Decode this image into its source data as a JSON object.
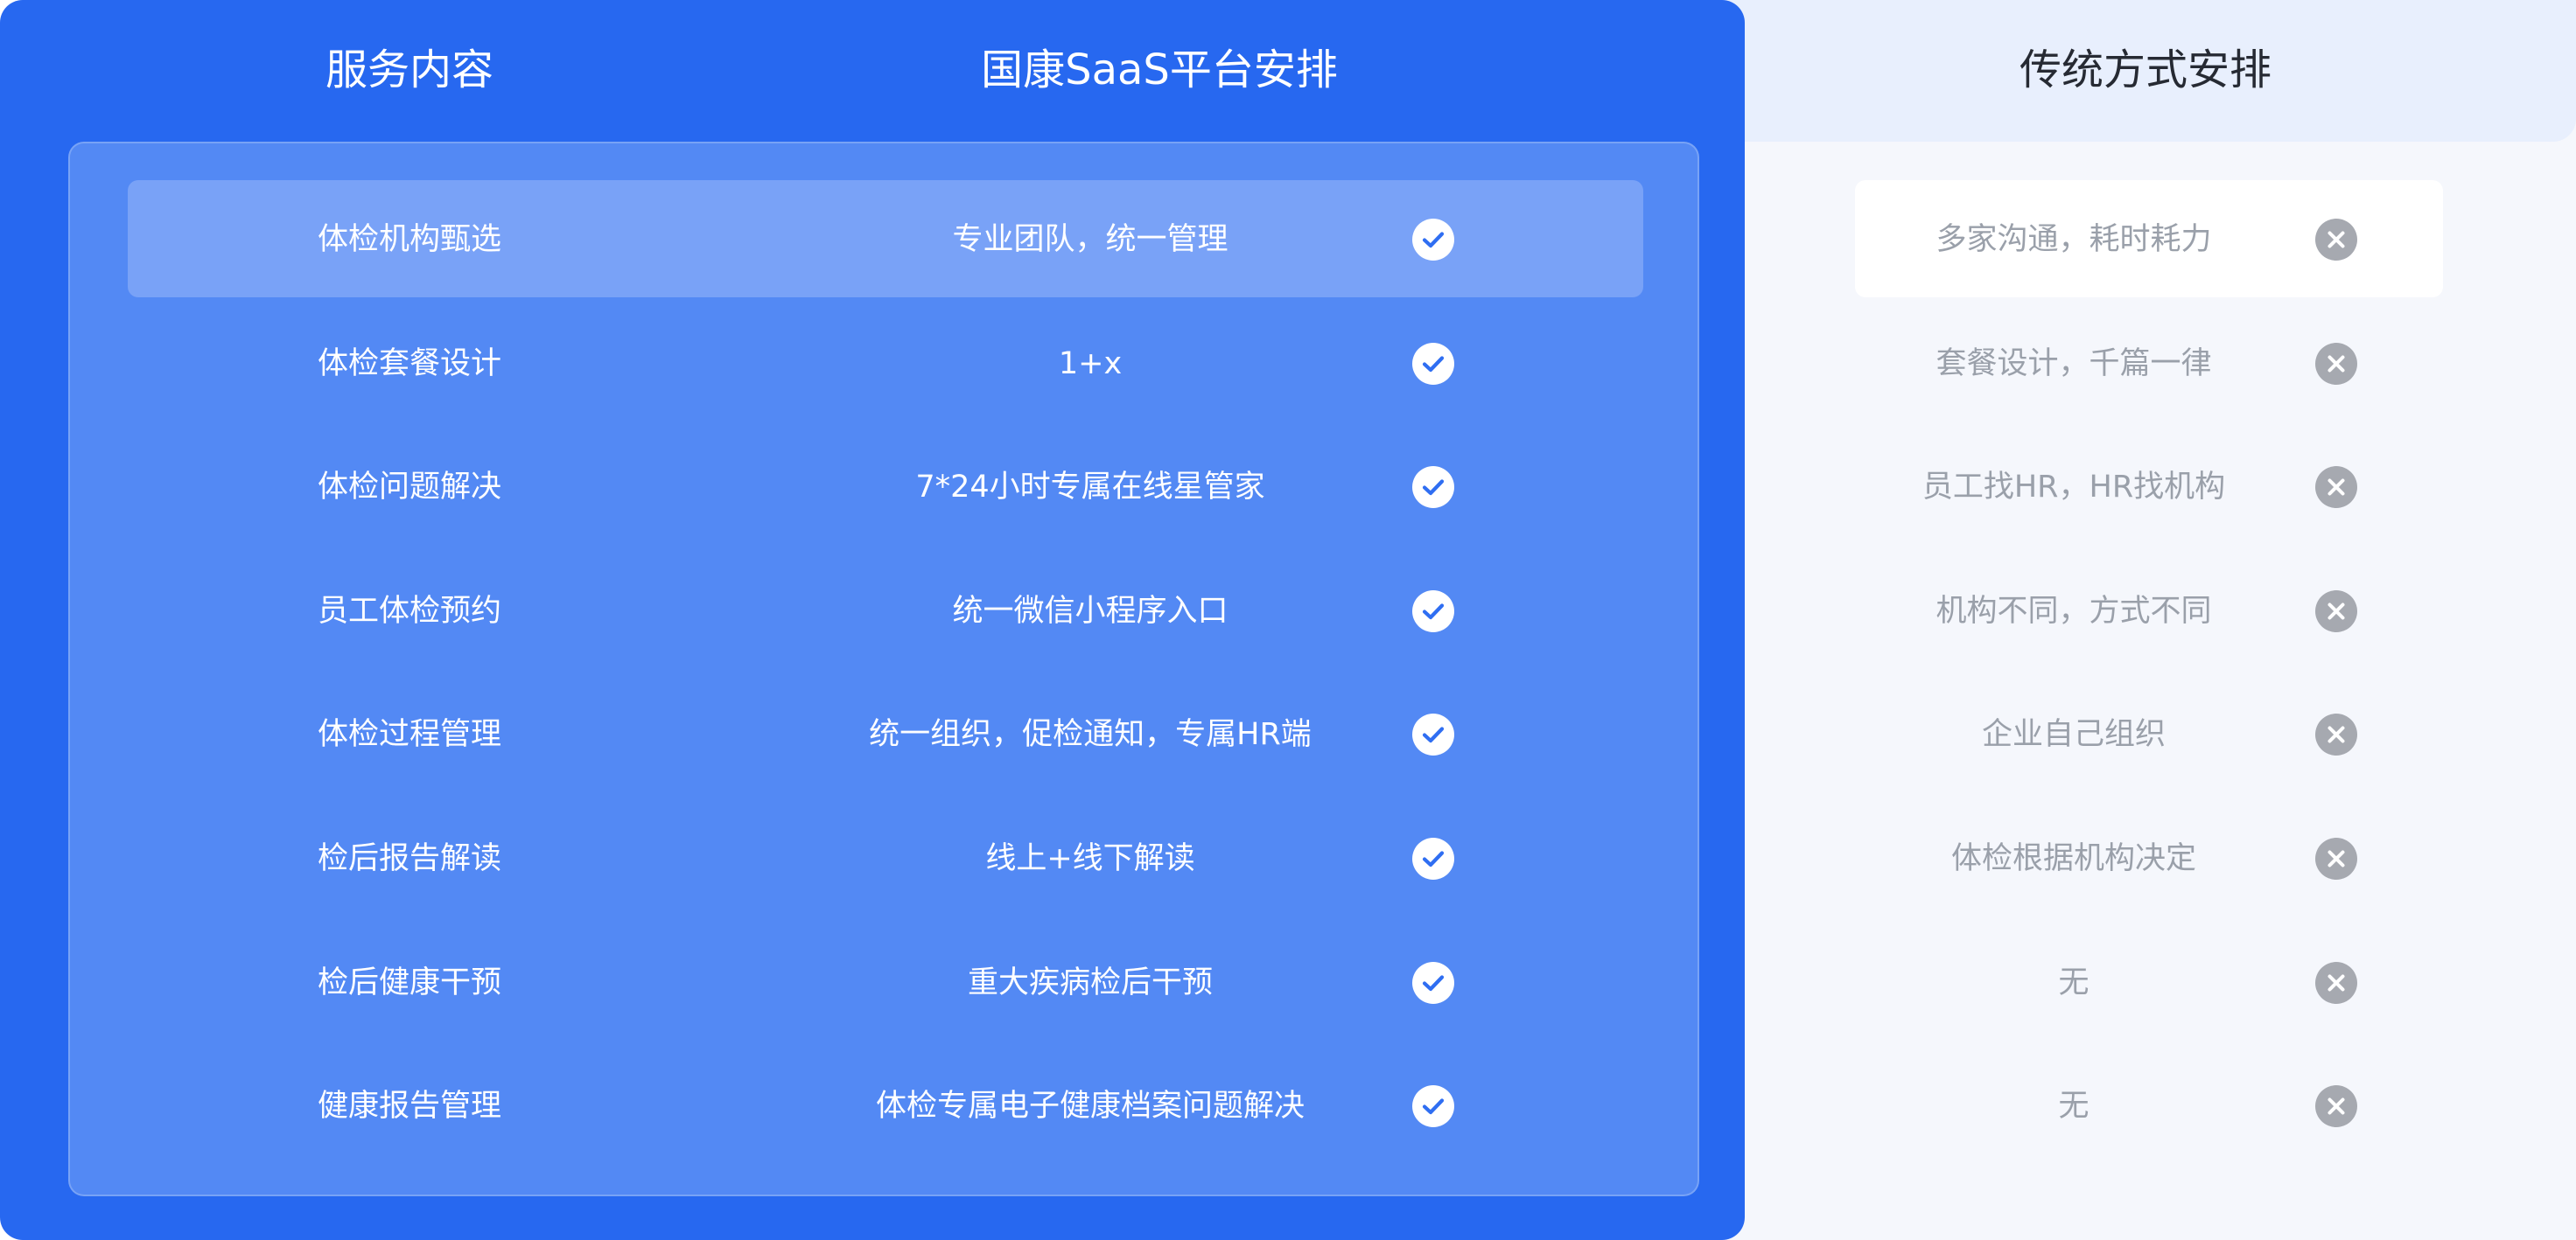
{
  "headers": {
    "service": "服务内容",
    "saas": "国康SaaS平台安排",
    "traditional": "传统方式安排"
  },
  "rows": [
    {
      "service": "体检机构甄选",
      "saas": "专业团队，统一管理",
      "traditional": "多家沟通，耗时耗力"
    },
    {
      "service": "体检套餐设计",
      "saas": "1+x",
      "traditional": "套餐设计，千篇一律"
    },
    {
      "service": "体检问题解决",
      "saas": "7*24小时专属在线星管家",
      "traditional": "员工找HR，HR找机构"
    },
    {
      "service": "员工体检预约",
      "saas": "统一微信小程序入口",
      "traditional": "机构不同，方式不同"
    },
    {
      "service": "体检过程管理",
      "saas": "统一组织，促检通知，专属HR端",
      "traditional": "企业自己组织"
    },
    {
      "service": "检后报告解读",
      "saas": "线上+线下解读",
      "traditional": "体检根据机构决定"
    },
    {
      "service": "检后健康干预",
      "saas": "重大疾病检后干预",
      "traditional": "无"
    },
    {
      "service": "健康报告管理",
      "saas": "体检专属电子健康档案问题解决",
      "traditional": "无"
    }
  ],
  "icons": {
    "saas": "check-circle-icon",
    "traditional": "x-circle-icon"
  },
  "colors": {
    "primary_blue": "#2768f0",
    "inner_blue": "#5389f4",
    "highlight_blue": "#79a2f7",
    "check_fill": "#ffffff",
    "check_mark": "#2f6ef2",
    "cross_fill": "#a6a9b0",
    "trad_text": "#9aa0aa",
    "trad_header": "#262a33",
    "trad_header_bg": "#e8effd",
    "trad_bg": "#f5f7fc"
  }
}
